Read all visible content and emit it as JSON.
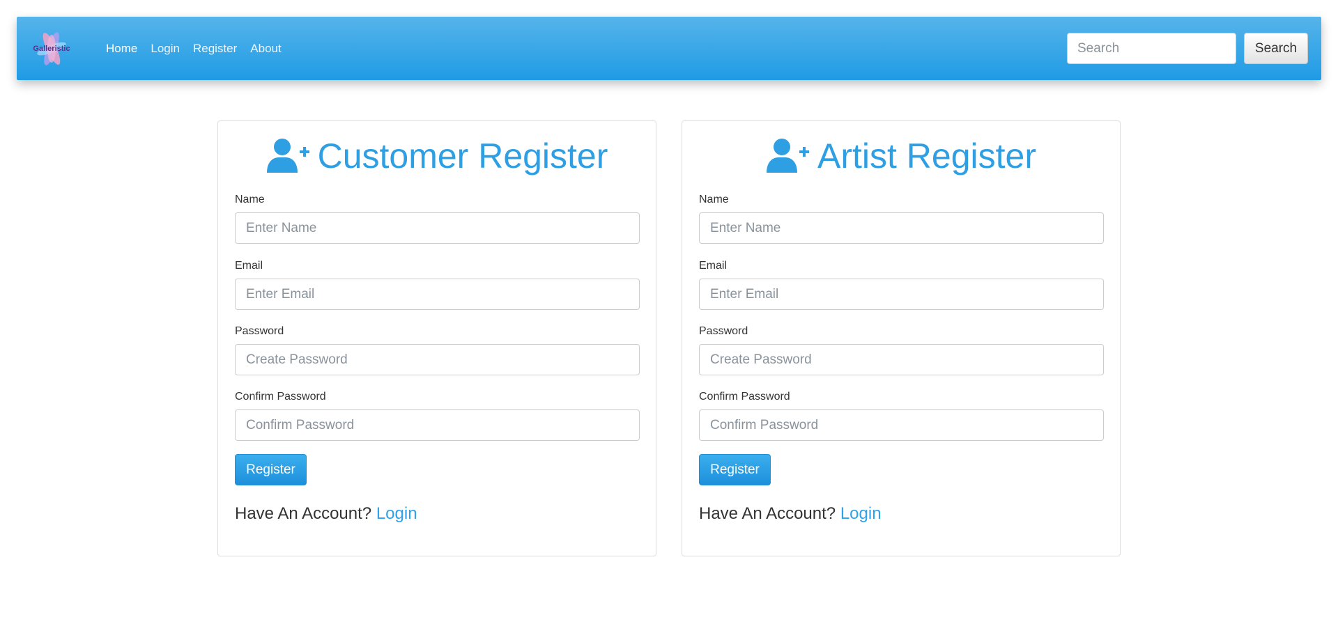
{
  "navbar": {
    "logo_text": "Galleristic",
    "links": [
      {
        "label": "Home",
        "active": true
      },
      {
        "label": "Login"
      },
      {
        "label": "Register"
      },
      {
        "label": "About"
      }
    ],
    "search": {
      "placeholder": "Search",
      "value": "",
      "button_label": "Search"
    }
  },
  "colors": {
    "accent": "#2e9fe3",
    "navbar_top": "#56b4ea",
    "navbar_bottom": "#1f9be5",
    "link": "#2ea3ea"
  },
  "customer": {
    "icon": "user-plus-icon",
    "title": "Customer Register",
    "fields": [
      {
        "label": "Name",
        "placeholder": "Enter Name"
      },
      {
        "label": "Email",
        "placeholder": "Enter Email"
      },
      {
        "label": "Password",
        "placeholder": "Create Password"
      },
      {
        "label": "Confirm Password",
        "placeholder": "Confirm Password"
      }
    ],
    "submit_label": "Register",
    "have_account_text": "Have An Account?",
    "login_link": "Login"
  },
  "artist": {
    "icon": "user-plus-icon",
    "title": "Artist Register",
    "fields": [
      {
        "label": "Name",
        "placeholder": "Enter Name"
      },
      {
        "label": "Email",
        "placeholder": "Enter Email"
      },
      {
        "label": "Password",
        "placeholder": "Create Password"
      },
      {
        "label": "Confirm Password",
        "placeholder": "Confirm Password"
      }
    ],
    "submit_label": "Register",
    "have_account_text": "Have An Account?",
    "login_link": "Login"
  }
}
